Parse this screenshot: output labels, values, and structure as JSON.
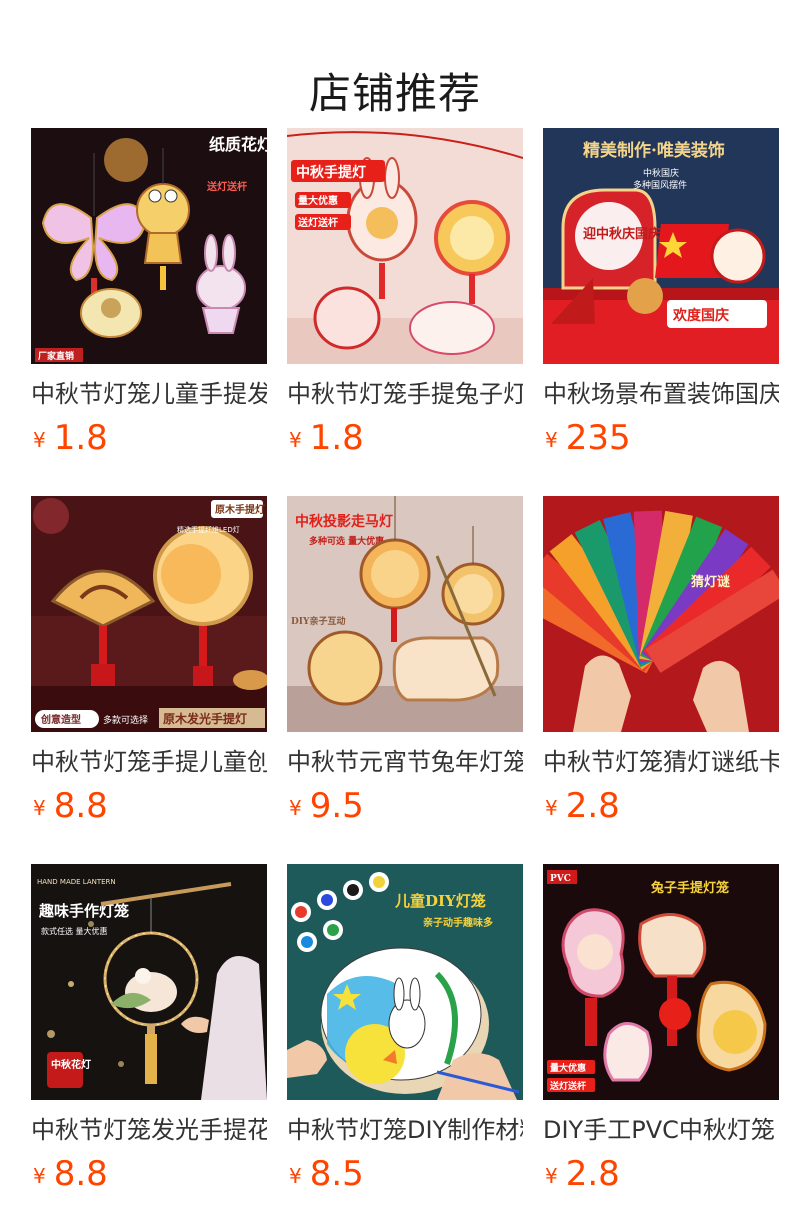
{
  "section": {
    "title": "店铺推荐"
  },
  "currency_symbol": "¥",
  "products": [
    {
      "name": "中秋节灯笼儿童手提发光",
      "price": "1.8",
      "image_text": [
        "纸质花灯",
        "送灯送杆",
        "厂家直销"
      ]
    },
    {
      "name": "中秋节灯笼手提兔子灯",
      "price": "1.8",
      "image_text": [
        "中秋手提灯",
        "量大优惠",
        "送灯送杆"
      ]
    },
    {
      "name": "中秋场景布置装饰国庆",
      "price": "235",
      "image_text": [
        "精美制作·唯美装饰",
        "中秋国庆",
        "多种国风摆件",
        "迎中秋庆国庆",
        "欢度国庆"
      ]
    },
    {
      "name": "中秋节灯笼手提儿童创意",
      "price": "8.8",
      "image_text": [
        "原木手提灯",
        "精选手提纤维LED灯",
        "创意造型",
        "多款可选择",
        "原木发光手提灯"
      ]
    },
    {
      "name": "中秋节元宵节兔年灯笼",
      "price": "9.5",
      "image_text": [
        "中秋投影走马灯",
        "多种可选 量大优惠",
        "DIY亲子互动"
      ]
    },
    {
      "name": "中秋节灯笼猜灯谜纸卡",
      "price": "2.8",
      "image_text": [
        "猜灯谜"
      ]
    },
    {
      "name": "中秋节灯笼发光手提花灯",
      "price": "8.8",
      "image_text": [
        "HAND MADE LANTERN",
        "趣味手作灯笼",
        "款式任选 量大优惠",
        "中秋花灯"
      ]
    },
    {
      "name": "中秋节灯笼DIY制作材料",
      "price": "8.5",
      "image_text": [
        "儿童DIY灯笼",
        "亲子动手趣味多"
      ]
    },
    {
      "name": "DIY手工PVC中秋灯笼",
      "price": "2.8",
      "image_text": [
        "PVC",
        "兔子手提灯笼",
        "量大优惠",
        "送灯送杆"
      ]
    }
  ],
  "colors": {
    "price": "#ff4400",
    "title": "#1a1a1a",
    "name": "#333333"
  }
}
